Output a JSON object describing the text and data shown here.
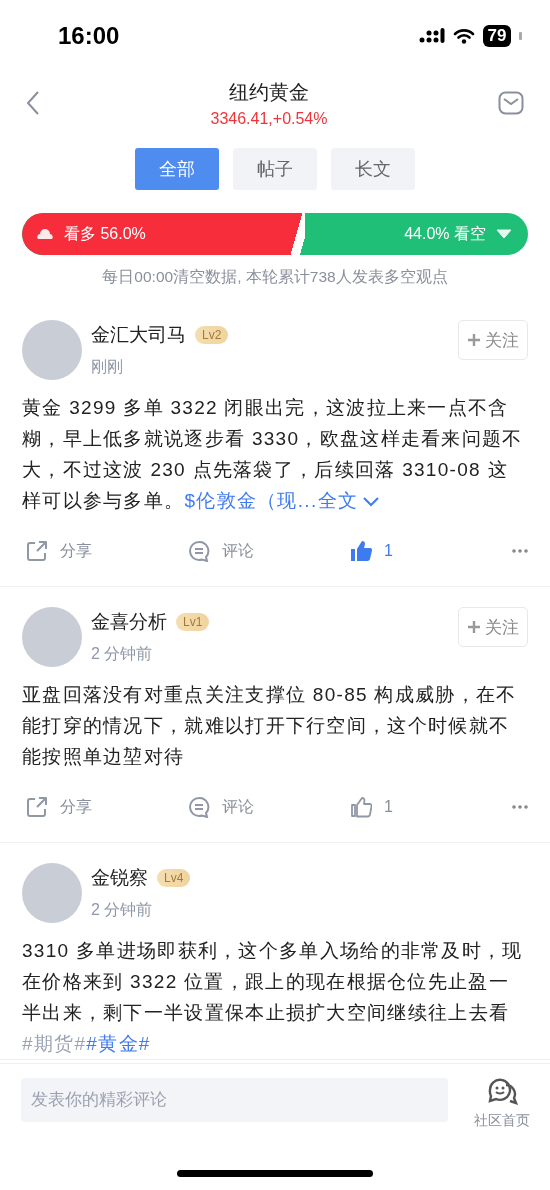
{
  "status_bar": {
    "time": "16:00",
    "battery": "79"
  },
  "header": {
    "title": "纽约黄金",
    "price": "3346.41,+0.54%"
  },
  "tabs": [
    {
      "label": "全部",
      "selected": true
    },
    {
      "label": "帖子",
      "selected": false
    },
    {
      "label": "长文",
      "selected": false
    }
  ],
  "sentiment": {
    "bull_label": "看多 56.0%",
    "bear_label": "44.0% 看空",
    "level": 0.56,
    "note": "每日00:00清空数据, 本轮累计738人发表多空观点"
  },
  "posts": [
    {
      "author": "金汇大司马",
      "badge": "Lv2",
      "time": "刚刚",
      "follow": "关注",
      "body": [
        {
          "kind": "text",
          "text": "黄金 3299 多单 3322 闭眼出完，这波拉上来一点不含糊，早上低多就说逐步看 3330，欧盘这样走看来问题不大，不过这波 230 点先落袋了，后续回落 3310-08 这样可以参与多单。"
        },
        {
          "kind": "topic",
          "text": "$伦敦金（现..."
        },
        {
          "kind": "expand",
          "text": "全文"
        }
      ],
      "share": "分享",
      "comment": "评论",
      "likes": "1",
      "liked": true
    },
    {
      "author": "金喜分析",
      "badge": "Lv1",
      "time": "2 分钟前",
      "follow": "关注",
      "body": [
        {
          "kind": "text",
          "text": "亚盘回落没有对重点关注支撑位 80-85 构成威胁，在不能打穿的情况下，就难以打开下行空间，这个时候就不能按照单边堃对待"
        }
      ],
      "share": "分享",
      "comment": "评论",
      "likes": "1",
      "liked": false
    },
    {
      "author": "金锐察",
      "badge": "Lv4",
      "time": "2 分钟前",
      "body": [
        {
          "kind": "text",
          "text": "3310 多单进场即获利，这个多单入场给的非常及时，现在价格来到 3322 位置，跟上的现在根据仓位先止盈一半出来，剩下一半设置保本止损扩大空间继续往上去看"
        },
        {
          "kind": "muted",
          "text": "#期货#"
        },
        {
          "kind": "topic",
          "text": "#黄金#"
        }
      ]
    }
  ],
  "bottom_bar": {
    "comment_placeholder": "发表你的精彩评论",
    "community_label": "社区首页"
  }
}
